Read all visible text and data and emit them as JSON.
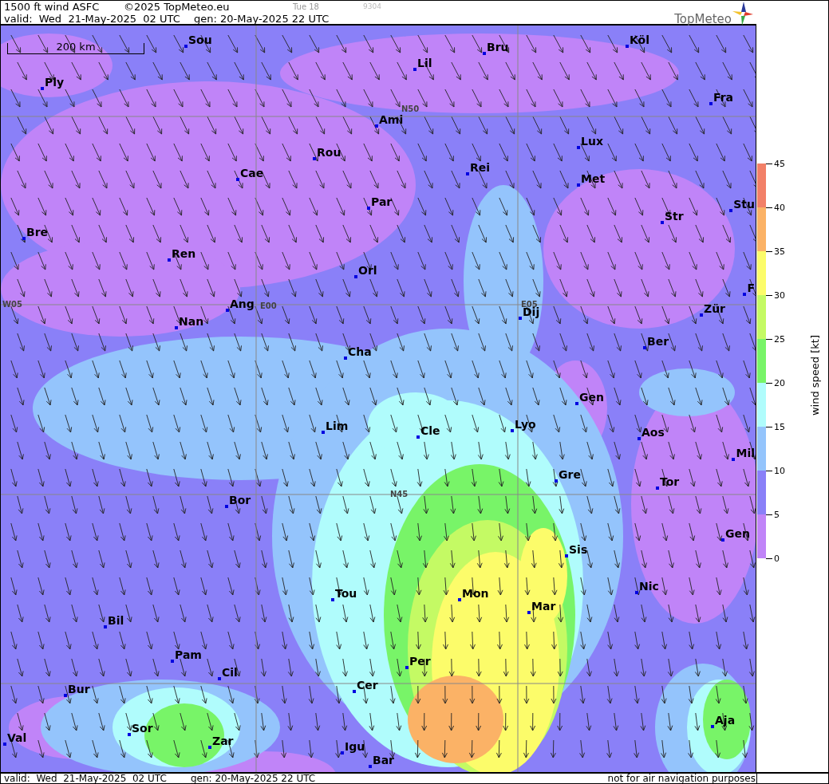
{
  "header": {
    "title": "1500 ft wind ASFC",
    "copyright": "©2025 TopMeteo.eu",
    "day": "Tue 18",
    "code": "9304",
    "valid": "valid:  Wed  21-May-2025  02 UTC",
    "generated": "gen: 20-May-2025 22 UTC",
    "logo_text": "TopMeteo"
  },
  "map": {
    "scale_bar": "200 km",
    "grid_labels": [
      "N50",
      "W05",
      "E00",
      "E05",
      "N45"
    ],
    "cities": [
      "Sou",
      "Lil",
      "Bru",
      "Köl",
      "Ply",
      "Ami",
      "Fra",
      "Lux",
      "Rou",
      "Cae",
      "Rei",
      "Met",
      "Par",
      "Stu",
      "Str",
      "Bre",
      "Ren",
      "Orl",
      "F",
      "Ang",
      "Nan",
      "Dij",
      "Zür",
      "Ber",
      "Cha",
      "Gen",
      "Lim",
      "Cle",
      "Lyo",
      "Aos",
      "Mil",
      "Gre",
      "Tor",
      "Bor",
      "Gen",
      "Sis",
      "Nic",
      "Tou",
      "Mon",
      "Mar",
      "Bil",
      "Pam",
      "Cil",
      "Per",
      "Cer",
      "Bur",
      "Aja",
      "Sor",
      "Val",
      "Zar",
      "Igu",
      "Bar"
    ]
  },
  "legend": {
    "title": "wind speed [kt]",
    "ticks": [
      "45",
      "40",
      "35",
      "30",
      "25",
      "20",
      "15",
      "10",
      "5",
      "0"
    ],
    "bands": [
      {
        "color": "#f28068"
      },
      {
        "color": "#fbb266"
      },
      {
        "color": "#fcfc6a"
      },
      {
        "color": "#c4fa64"
      },
      {
        "color": "#78f468"
      },
      {
        "color": "#b0fcfc"
      },
      {
        "color": "#94c4fc"
      },
      {
        "color": "#8a80f8"
      },
      {
        "color": "#c084f8"
      }
    ]
  },
  "footer": {
    "valid": "valid:  Wed  21-May-2025  02 UTC",
    "generated": "gen: 20-May-2025 22 UTC",
    "disclaimer": "not for air navigation purposes"
  }
}
